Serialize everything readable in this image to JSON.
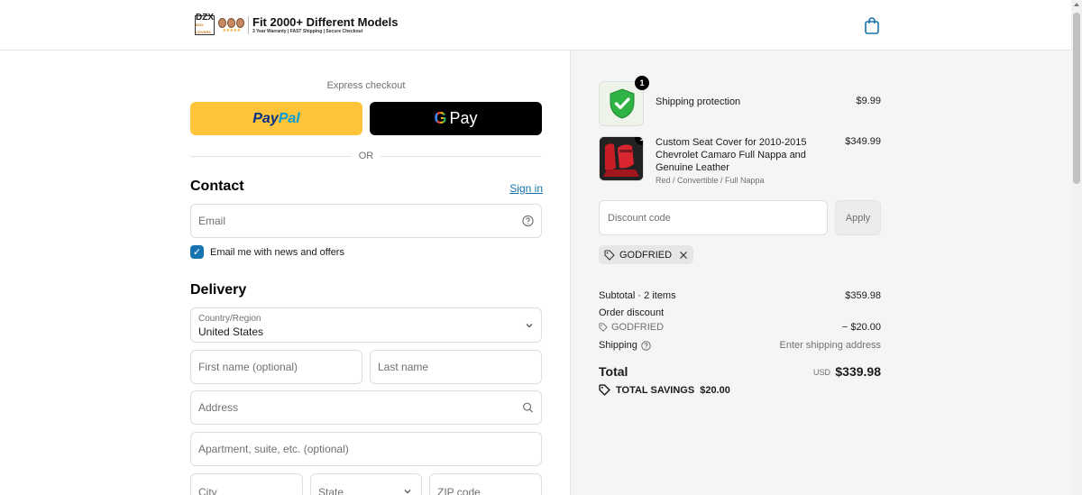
{
  "header": {
    "logo_brand": "DZX",
    "logo_brand_sub": "BOX COVERS",
    "logo_title": "Fit 2000+ Different Models",
    "logo_tagline": "3 Year Warranty | FAST Shipping | Secure Checkout",
    "logo_stars": "★★★★★",
    "cart_icon": "shopping-bag-icon"
  },
  "express": {
    "label": "Express checkout",
    "paypal_pay": "Pay",
    "paypal_pal": "Pal",
    "gpay_g": "G",
    "gpay_label": "Pay",
    "or": "OR"
  },
  "contact": {
    "title": "Contact",
    "signin": "Sign in",
    "email_placeholder": "Email",
    "newsletter_label": "Email me with news and offers",
    "newsletter_checked": true
  },
  "delivery": {
    "title": "Delivery",
    "country_label": "Country/Region",
    "country_value": "United States",
    "first_name_placeholder": "First name (optional)",
    "last_name_placeholder": "Last name",
    "address_placeholder": "Address",
    "apartment_placeholder": "Apartment, suite, etc. (optional)",
    "city_placeholder": "City",
    "state_placeholder": "State",
    "zip_placeholder": "ZIP code"
  },
  "order": {
    "items": [
      {
        "title": "Shipping protection",
        "variant": "",
        "price": "$9.99",
        "quantity": "1"
      },
      {
        "title": "Custom Seat Cover for 2010-2015 Chevrolet Camaro Full Nappa and Genuine Leather",
        "variant": "Red / Convertible / Full Nappa",
        "price": "$349.99",
        "quantity": "1"
      }
    ],
    "discount_placeholder": "Discount code",
    "apply_label": "Apply",
    "applied_code": "GODFRIED",
    "subtotal_label": "Subtotal · 2 items",
    "subtotal_value": "$359.98",
    "order_discount_label": "Order discount",
    "discount_code_label": "GODFRIED",
    "discount_value": "− $20.00",
    "shipping_label": "Shipping",
    "shipping_value": "Enter shipping address",
    "total_label": "Total",
    "total_currency": "USD",
    "total_value": "$339.98",
    "savings_label": "TOTAL SAVINGS",
    "savings_value": "$20.00"
  },
  "colors": {
    "link": "#1773b0",
    "paypal": "#ffc439",
    "accent_green": "#2fb344"
  }
}
